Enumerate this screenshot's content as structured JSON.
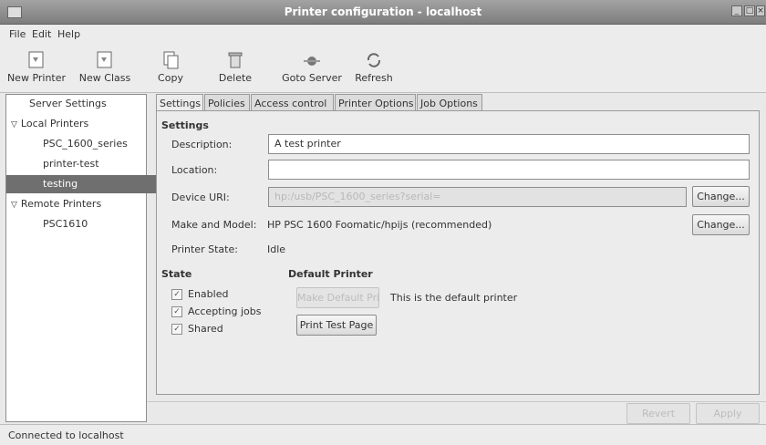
{
  "window": {
    "title": "Printer configuration - localhost"
  },
  "menu": [
    "File",
    "Edit",
    "Help"
  ],
  "toolbar": {
    "new_printer": "New Printer",
    "new_class": "New Class",
    "copy": "Copy",
    "delete": "Delete",
    "goto_server": "Goto Server",
    "refresh": "Refresh"
  },
  "sidebar": {
    "server_settings": "Server Settings",
    "local_printers": "Local Printers",
    "local_items": [
      "PSC_1600_series",
      "printer-test",
      "testing"
    ],
    "remote_printers": "Remote Printers",
    "remote_items": [
      "PSC1610"
    ]
  },
  "tabs": [
    "Settings",
    "Policies",
    "Access control",
    "Printer Options",
    "Job Options"
  ],
  "settings": {
    "heading": "Settings",
    "description_label": "Description:",
    "description_value": "A test printer",
    "location_label": "Location:",
    "location_value": "",
    "device_uri_label": "Device URI:",
    "device_uri_value": "hp:/usb/PSC_1600_series?serial=",
    "change_label": "Change...",
    "make_model_label": "Make and Model:",
    "make_model_value": "HP PSC 1600 Foomatic/hpijs (recommended)",
    "printer_state_label": "Printer State:",
    "printer_state_value": "Idle"
  },
  "state": {
    "heading": "State",
    "enabled": "Enabled",
    "accepting_jobs": "Accepting jobs",
    "shared": "Shared"
  },
  "default_printer": {
    "heading": "Default Printer",
    "make_default_label": "Make Default Printer",
    "default_text": "This is the default printer",
    "print_test_page": "Print Test Page"
  },
  "footer": {
    "revert": "Revert",
    "apply": "Apply"
  },
  "status": "Connected to localhost"
}
